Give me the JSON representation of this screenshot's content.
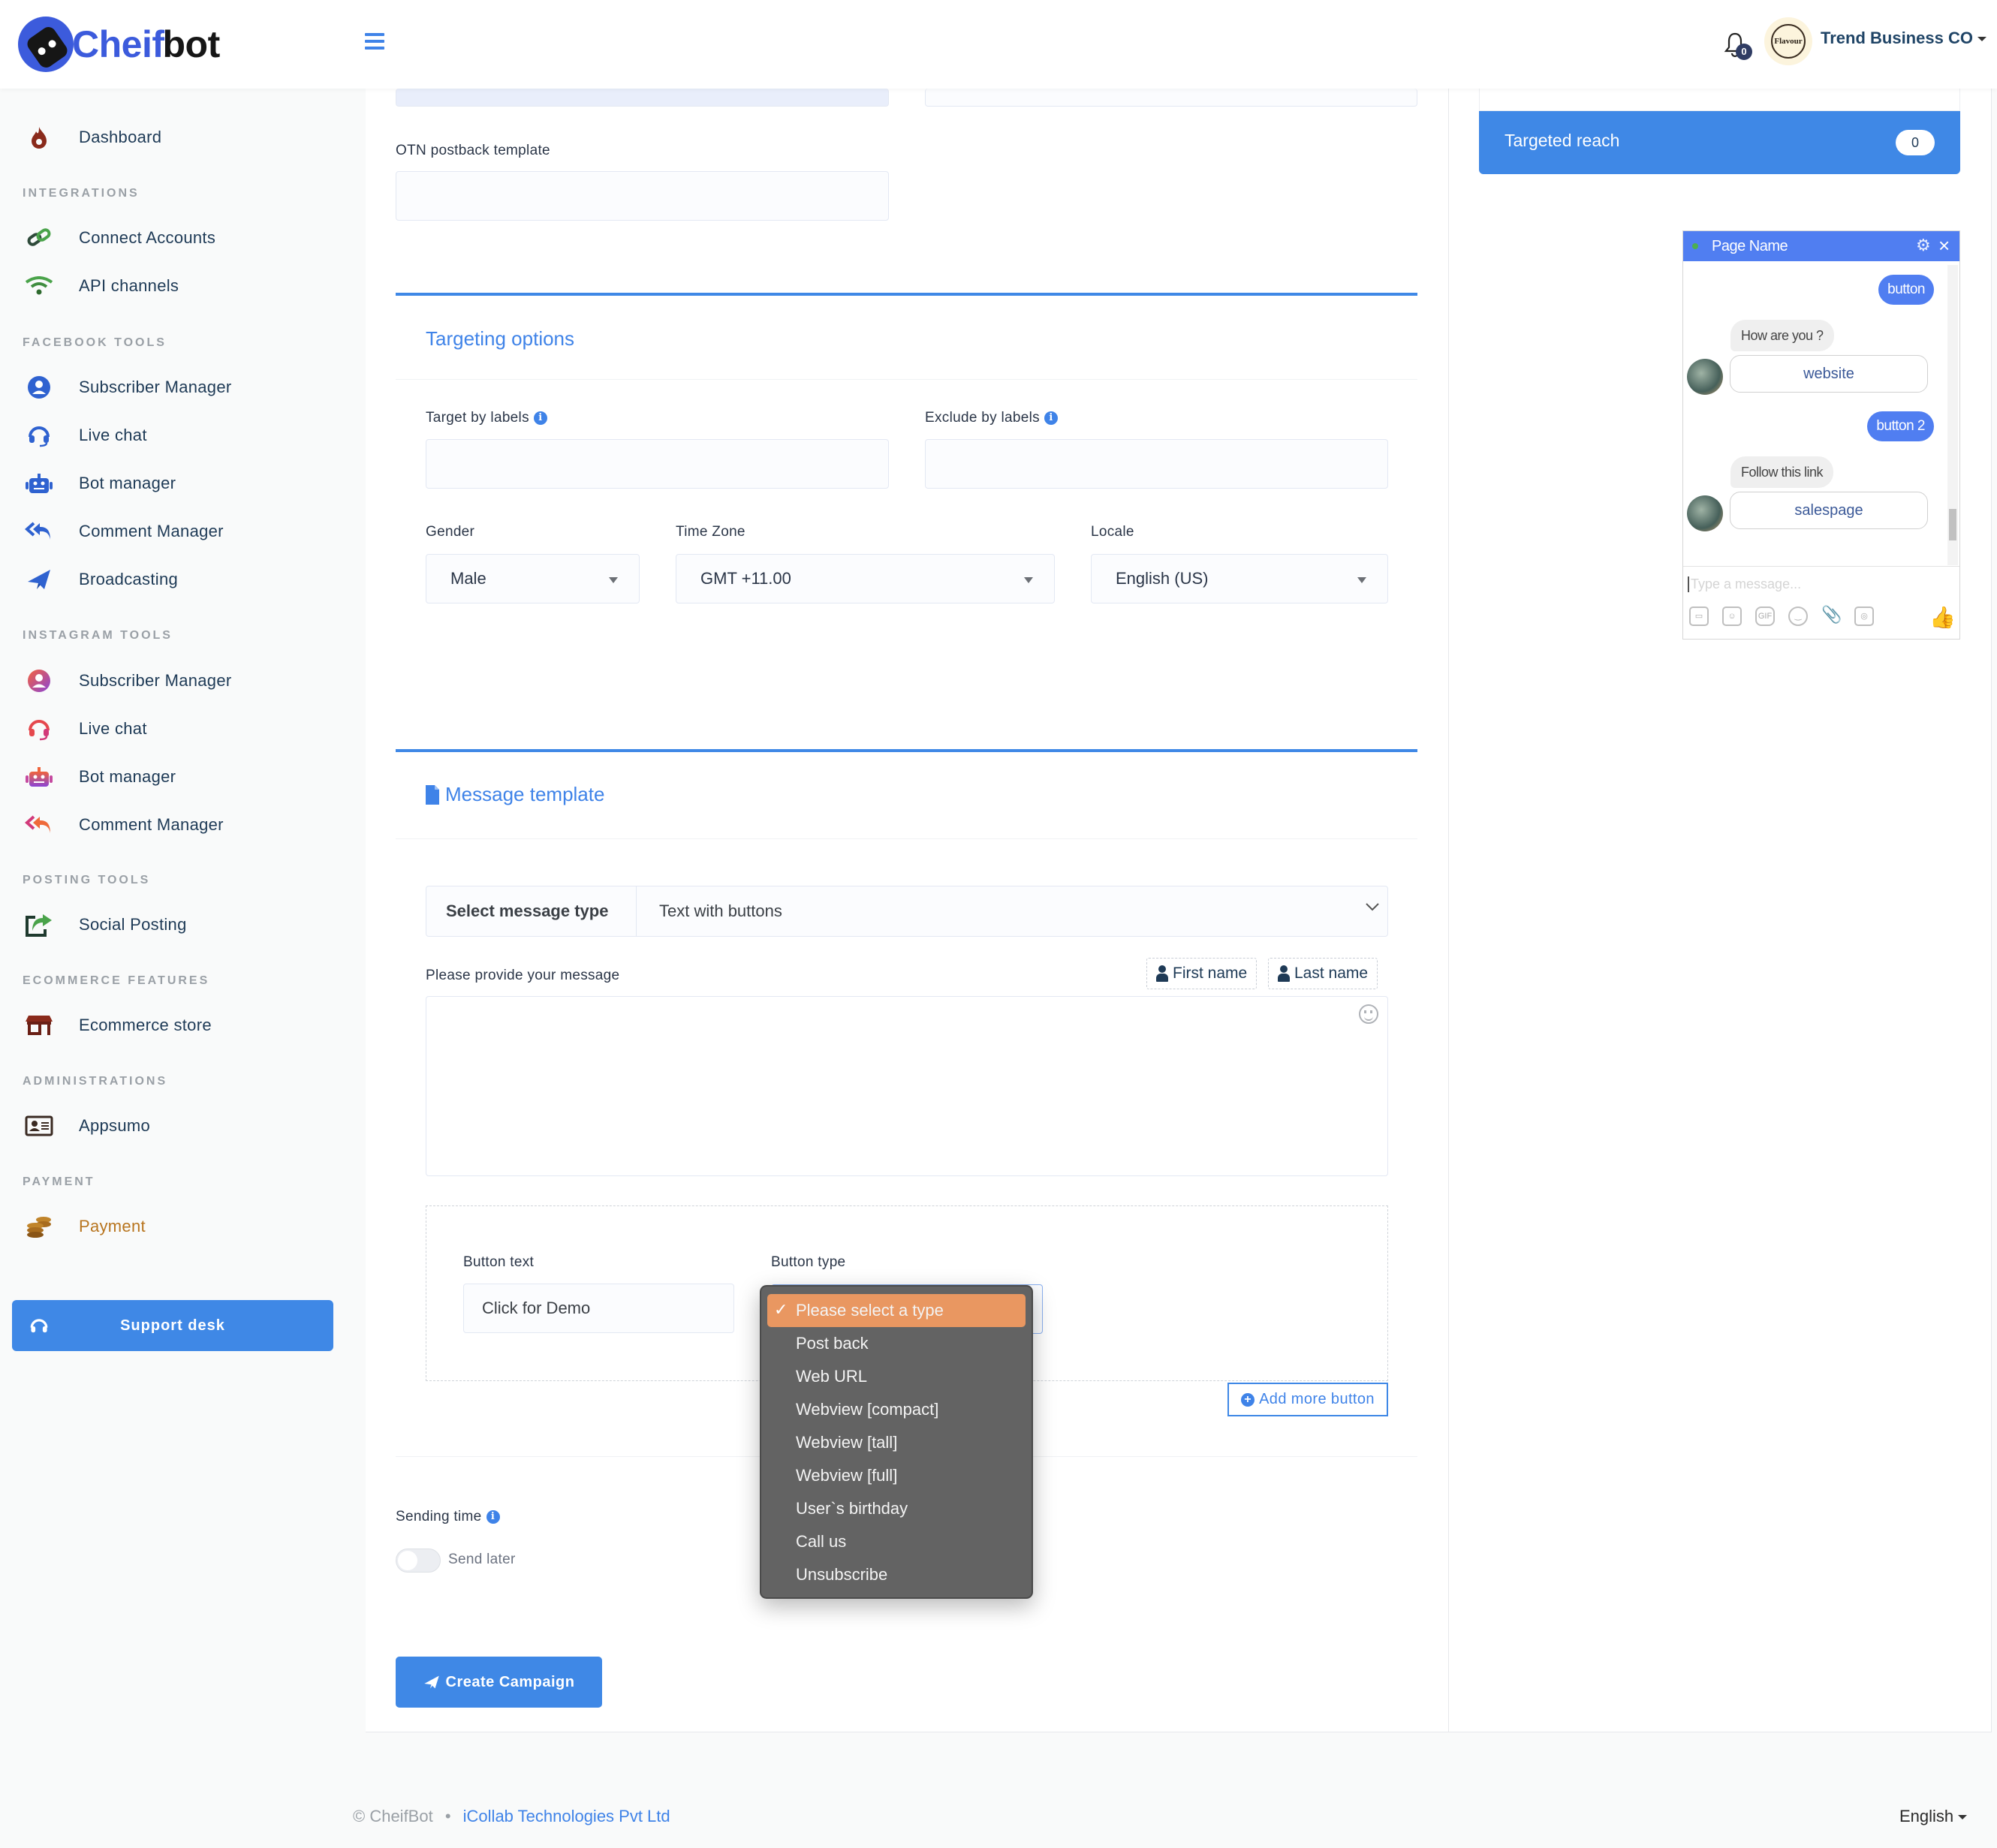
{
  "header": {
    "brand_part1": "Cheif",
    "brand_part2": "bot",
    "notification_count": "0",
    "avatar_text": "Flavour",
    "account_name": "Trend Business CO"
  },
  "sidebar": {
    "dashboard": "Dashboard",
    "sections": {
      "integrations": "INTEGRATIONS",
      "facebook_tools": "FACEBOOK TOOLS",
      "instagram_tools": "INSTAGRAM TOOLS",
      "posting_tools": "POSTING TOOLS",
      "ecommerce_features": "ECOMMERCE FEATURES",
      "administrations": "ADMINISTRATIONS",
      "payment": "PAYMENT"
    },
    "items": {
      "connect_accounts": "Connect Accounts",
      "api_channels": "API channels",
      "fb_subscriber_manager": "Subscriber Manager",
      "fb_live_chat": "Live chat",
      "fb_bot_manager": "Bot manager",
      "fb_comment_manager": "Comment Manager",
      "fb_broadcasting": "Broadcasting",
      "ig_subscriber_manager": "Subscriber Manager",
      "ig_live_chat": "Live chat",
      "ig_bot_manager": "Bot manager",
      "ig_comment_manager": "Comment Manager",
      "social_posting": "Social Posting",
      "ecommerce_store": "Ecommerce store",
      "appsumo": "Appsumo",
      "payment": "Payment"
    },
    "support_desk": "Support desk",
    "payment_color": "#b8751f"
  },
  "form": {
    "otn_label": "OTN postback template",
    "otn_value": "",
    "targeting": {
      "title": "Targeting options",
      "target_labels": "Target by labels",
      "exclude_labels": "Exclude by labels",
      "gender_label": "Gender",
      "gender_value": "Male",
      "timezone_label": "Time Zone",
      "timezone_value": "GMT +11.00",
      "locale_label": "Locale",
      "locale_value": "English (US)"
    },
    "message_template": {
      "title": "Message template",
      "select_type_label": "Select message type",
      "select_type_value": "Text with buttons",
      "message_label": "Please provide your message",
      "first_name_tag": "First name",
      "last_name_tag": "Last name",
      "message_value": "",
      "button_text_label": "Button text",
      "button_text_value": "Click for Demo",
      "button_type_label": "Button type",
      "button_type_options": [
        "Please select a type",
        "Post back",
        "Web URL",
        "Webview [compact]",
        "Webview [tall]",
        "Webview [full]",
        "User`s birthday",
        "Call us",
        "Unsubscribe"
      ],
      "button_type_selected": "Please select a type",
      "add_more_button": "Add more button"
    },
    "sending_time_label": "Sending time",
    "send_later_label": "Send later",
    "send_later_enabled": false,
    "create_campaign": "Create Campaign"
  },
  "right_panel": {
    "targeted_reach_label": "Targeted reach",
    "targeted_reach_value": "0",
    "chat_preview": {
      "page_name": "Page Name",
      "messages": {
        "out1": "button",
        "in1": "How are you ?",
        "btn1": "website",
        "out2": "button 2",
        "in2": "Follow this link",
        "btn2": "salespage"
      },
      "input_placeholder": "Type a message..."
    }
  },
  "footer": {
    "copyright": "© CheifBot",
    "separator": "•",
    "company_link": "iCollab Technologies Pvt Ltd",
    "language": "English"
  }
}
